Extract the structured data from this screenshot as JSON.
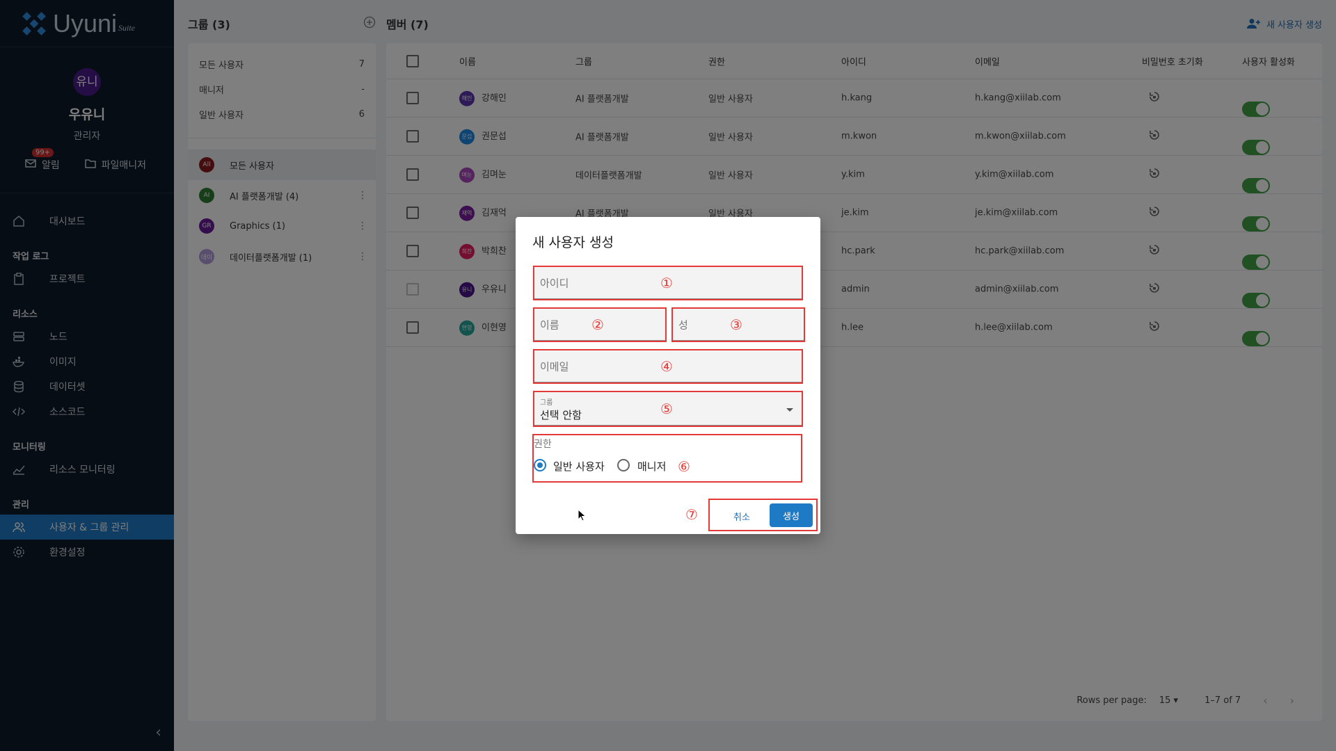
{
  "sidebar": {
    "logo_text": "Uyuni",
    "logo_suite": "Suite",
    "profile": {
      "avatar": "유니",
      "name": "우유니",
      "role": "관리자"
    },
    "actions": {
      "notif_badge": "99+",
      "notif_label": "알림",
      "files_label": "파일매니저"
    },
    "dashboard": "대시보드",
    "sections": {
      "worklog": "작업 로그",
      "resources": "리소스",
      "monitoring": "모니터링",
      "admin": "관리"
    },
    "items": {
      "project": "프로젝트",
      "node": "노드",
      "image": "이미지",
      "dataset": "데이터셋",
      "sourcecode": "소스코드",
      "resource_monitoring": "리소스 모니터링",
      "user_group": "사용자 & 그룹 관리",
      "settings": "환경설정"
    }
  },
  "groups": {
    "title": "그룹 (3)",
    "stats": [
      {
        "label": "모든 사용자",
        "value": "7"
      },
      {
        "label": "매니저",
        "value": "-"
      },
      {
        "label": "일반 사용자",
        "value": "6"
      }
    ],
    "list": [
      {
        "avatar": "All",
        "label": "모든 사용자",
        "color": "#8b1a1a"
      },
      {
        "avatar": "AI",
        "label": "AI 플랫폼개발 (4)",
        "color": "#2e7d32"
      },
      {
        "avatar": "GR",
        "label": "Graphics (1)",
        "color": "#6a1b9a"
      },
      {
        "avatar": "데이",
        "label": "데이터플랫폼개발 (1)",
        "color": "#b39ddb"
      }
    ]
  },
  "members": {
    "title": "멤버 (7)",
    "new_user_label": "새 사용자 생성",
    "columns": [
      "이름",
      "그룹",
      "권한",
      "아이디",
      "이메일",
      "비밀번호 초기화",
      "사용자 활성화"
    ],
    "rows": [
      {
        "avatar": "해인",
        "avatar_color": "#5e35b1",
        "name": "강해인",
        "group": "AI 플랫폼개발",
        "role": "일반 사용자",
        "id": "h.kang",
        "email": "h.kang@xiilab.com"
      },
      {
        "avatar": "문섭",
        "avatar_color": "#1e88e5",
        "name": "권문섭",
        "group": "AI 플랫폼개발",
        "role": "일반 사용자",
        "id": "m.kwon",
        "email": "m.kwon@xiilab.com"
      },
      {
        "avatar": "며눈",
        "avatar_color": "#ab47bc",
        "name": "김며눈",
        "group": "데이터플랫폼개발",
        "role": "일반 사용자",
        "id": "y.kim",
        "email": "y.kim@xiilab.com"
      },
      {
        "avatar": "재억",
        "avatar_color": "#7b1fa2",
        "name": "김재억",
        "group": "AI 플랫폼개발",
        "role": "일반 사용자",
        "id": "je.kim",
        "email": "je.kim@xiilab.com"
      },
      {
        "avatar": "희찬",
        "avatar_color": "#e91e63",
        "name": "박희찬",
        "group": "",
        "role": "",
        "id": "hc.park",
        "email": "hc.park@xiilab.com"
      },
      {
        "avatar": "유니",
        "avatar_color": "#4a148c",
        "name": "우유니",
        "group": "",
        "role": "",
        "id": "admin",
        "email": "admin@xiilab.com"
      },
      {
        "avatar": "현영",
        "avatar_color": "#26a69a",
        "name": "이현영",
        "group": "",
        "role": "",
        "id": "h.lee",
        "email": "h.lee@xiilab.com"
      }
    ],
    "pagination": {
      "rows_label": "Rows per page:",
      "rows_value": "15",
      "range": "1–7 of 7"
    }
  },
  "dialog": {
    "title": "새 사용자 생성",
    "id_placeholder": "아이디",
    "first_name_placeholder": "이름",
    "last_name_placeholder": "성",
    "email_placeholder": "이메일",
    "group_label": "그룹",
    "group_value": "선택 안함",
    "role_label": "권한",
    "role_options": [
      "일반 사용자",
      "매니저"
    ],
    "role_selected": "일반 사용자",
    "cancel": "취소",
    "create": "생성",
    "annotations": [
      "①",
      "②",
      "③",
      "④",
      "⑤",
      "⑥",
      "⑦"
    ],
    "annotation_color": "#e53935"
  }
}
